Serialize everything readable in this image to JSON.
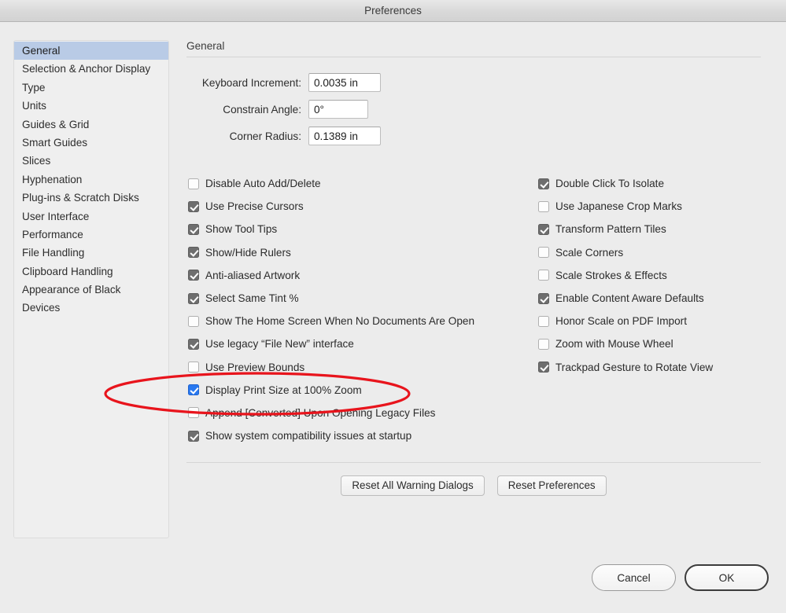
{
  "window": {
    "title": "Preferences"
  },
  "sidebar": {
    "items": [
      {
        "label": "General",
        "selected": true
      },
      {
        "label": "Selection & Anchor Display",
        "selected": false
      },
      {
        "label": "Type",
        "selected": false
      },
      {
        "label": "Units",
        "selected": false
      },
      {
        "label": "Guides & Grid",
        "selected": false
      },
      {
        "label": "Smart Guides",
        "selected": false
      },
      {
        "label": "Slices",
        "selected": false
      },
      {
        "label": "Hyphenation",
        "selected": false
      },
      {
        "label": "Plug-ins & Scratch Disks",
        "selected": false
      },
      {
        "label": "User Interface",
        "selected": false
      },
      {
        "label": "Performance",
        "selected": false
      },
      {
        "label": "File Handling",
        "selected": false
      },
      {
        "label": "Clipboard Handling",
        "selected": false
      },
      {
        "label": "Appearance of Black",
        "selected": false
      },
      {
        "label": "Devices",
        "selected": false
      }
    ]
  },
  "content": {
    "section_title": "General",
    "fields": [
      {
        "label": "Keyboard Increment:",
        "value": "0.0035 in",
        "width": "wide"
      },
      {
        "label": "Constrain Angle:",
        "value": "0°",
        "width": "med"
      },
      {
        "label": "Corner Radius:",
        "value": "0.1389 in",
        "width": "wide"
      }
    ],
    "checkboxes_left": [
      {
        "label": "Disable Auto Add/Delete",
        "state": "off"
      },
      {
        "label": "Use Precise Cursors",
        "state": "on"
      },
      {
        "label": "Show Tool Tips",
        "state": "on"
      },
      {
        "label": "Show/Hide Rulers",
        "state": "on"
      },
      {
        "label": "Anti-aliased Artwork",
        "state": "on"
      },
      {
        "label": "Select Same Tint %",
        "state": "on"
      },
      {
        "label": "Show The Home Screen When No Documents Are Open",
        "state": "off"
      },
      {
        "label": "Use legacy “File New” interface",
        "state": "on"
      },
      {
        "label": "Use Preview Bounds",
        "state": "off"
      },
      {
        "label": "Display Print Size at 100% Zoom",
        "state": "on-blue"
      },
      {
        "label": "Append [Converted] Upon Opening Legacy Files",
        "state": "off"
      },
      {
        "label": "Show system compatibility issues at startup",
        "state": "on"
      }
    ],
    "checkboxes_right": [
      {
        "label": "Double Click To Isolate",
        "state": "on"
      },
      {
        "label": "Use Japanese Crop Marks",
        "state": "off"
      },
      {
        "label": "Transform Pattern Tiles",
        "state": "on"
      },
      {
        "label": "Scale Corners",
        "state": "off"
      },
      {
        "label": "Scale Strokes & Effects",
        "state": "off"
      },
      {
        "label": "Enable Content Aware Defaults",
        "state": "on"
      },
      {
        "label": "Honor Scale on PDF Import",
        "state": "off"
      },
      {
        "label": "Zoom with Mouse Wheel",
        "state": "off"
      },
      {
        "label": "Trackpad Gesture to Rotate View",
        "state": "on"
      }
    ],
    "reset_buttons": [
      {
        "label": "Reset All Warning Dialogs"
      },
      {
        "label": "Reset Preferences"
      }
    ]
  },
  "footer": {
    "cancel_label": "Cancel",
    "ok_label": "OK"
  },
  "annotation": {
    "shape": "ellipse-highlight",
    "color": "#e8141c",
    "target": "Display Print Size at 100% Zoom"
  }
}
